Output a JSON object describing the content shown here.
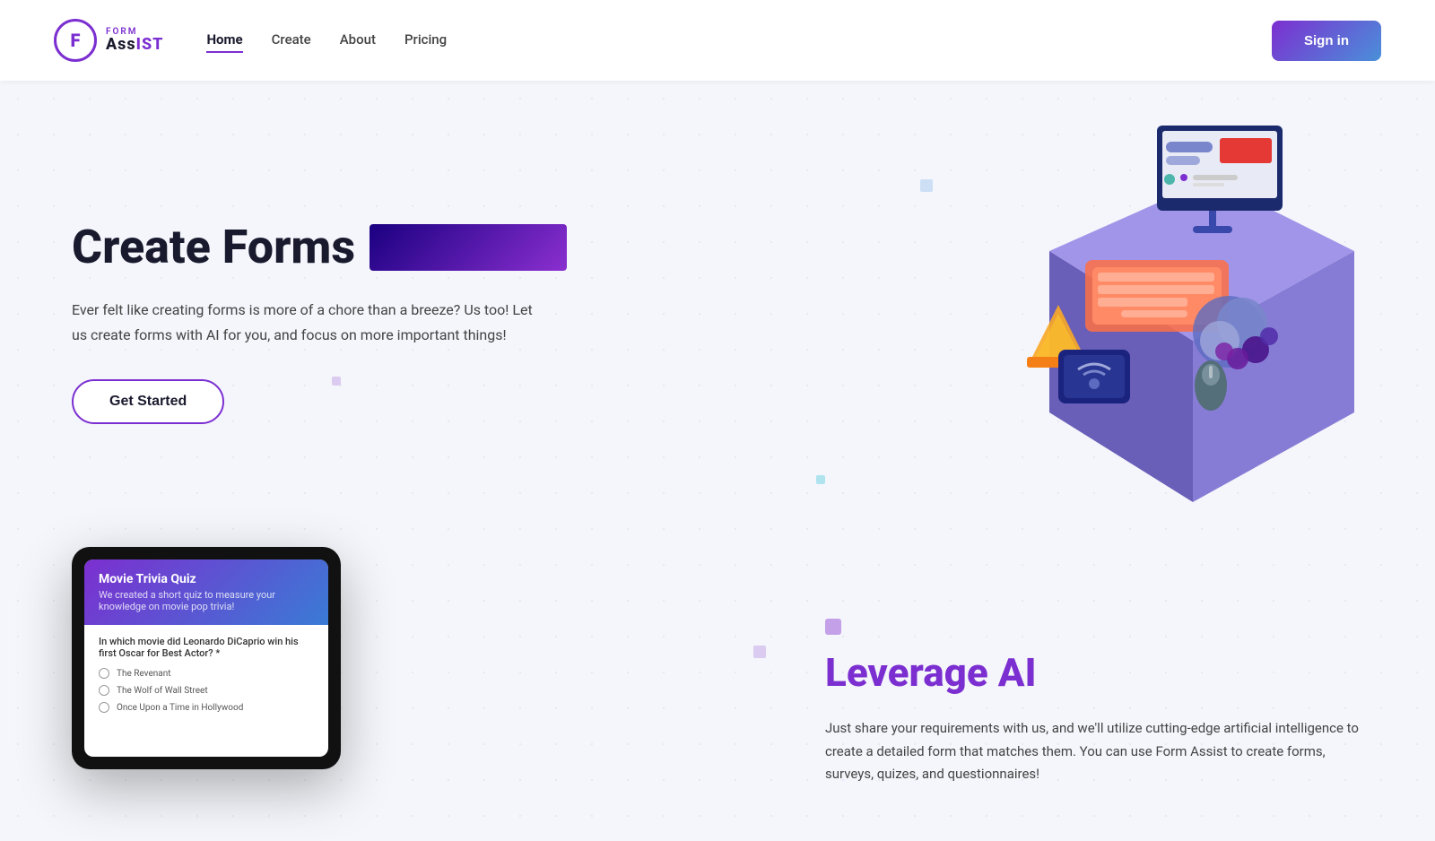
{
  "nav": {
    "logo_form": "FORM",
    "logo_assist": "ASSIST",
    "links": [
      {
        "label": "Home",
        "active": true
      },
      {
        "label": "Create",
        "active": false
      },
      {
        "label": "About",
        "active": false
      },
      {
        "label": "Pricing",
        "active": false
      }
    ],
    "sign_in": "Sign in"
  },
  "hero": {
    "title_text": "Create Forms",
    "description": "Ever felt like creating forms is more of a chore than a breeze? Us too! Let us create forms with AI for you, and focus on more important things!",
    "cta": "Get Started"
  },
  "tablet": {
    "title": "Movie Trivia Quiz",
    "subtitle": "We created a short quiz to measure your knowledge on movie pop trivia!",
    "question": "In which movie did Leonardo DiCaprio win his first Oscar for Best Actor? *",
    "options": [
      "The Revenant",
      "The Wolf of Wall Street",
      "Once Upon a Time in Hollywood"
    ]
  },
  "leverage": {
    "prefix": "Leverage ",
    "highlight": "AI",
    "description": "Just share your requirements with us, and we'll utilize cutting-edge artificial intelligence to create a detailed form that matches them. You can use Form Assist to create forms, surveys, quizes, and questionnaires!"
  }
}
